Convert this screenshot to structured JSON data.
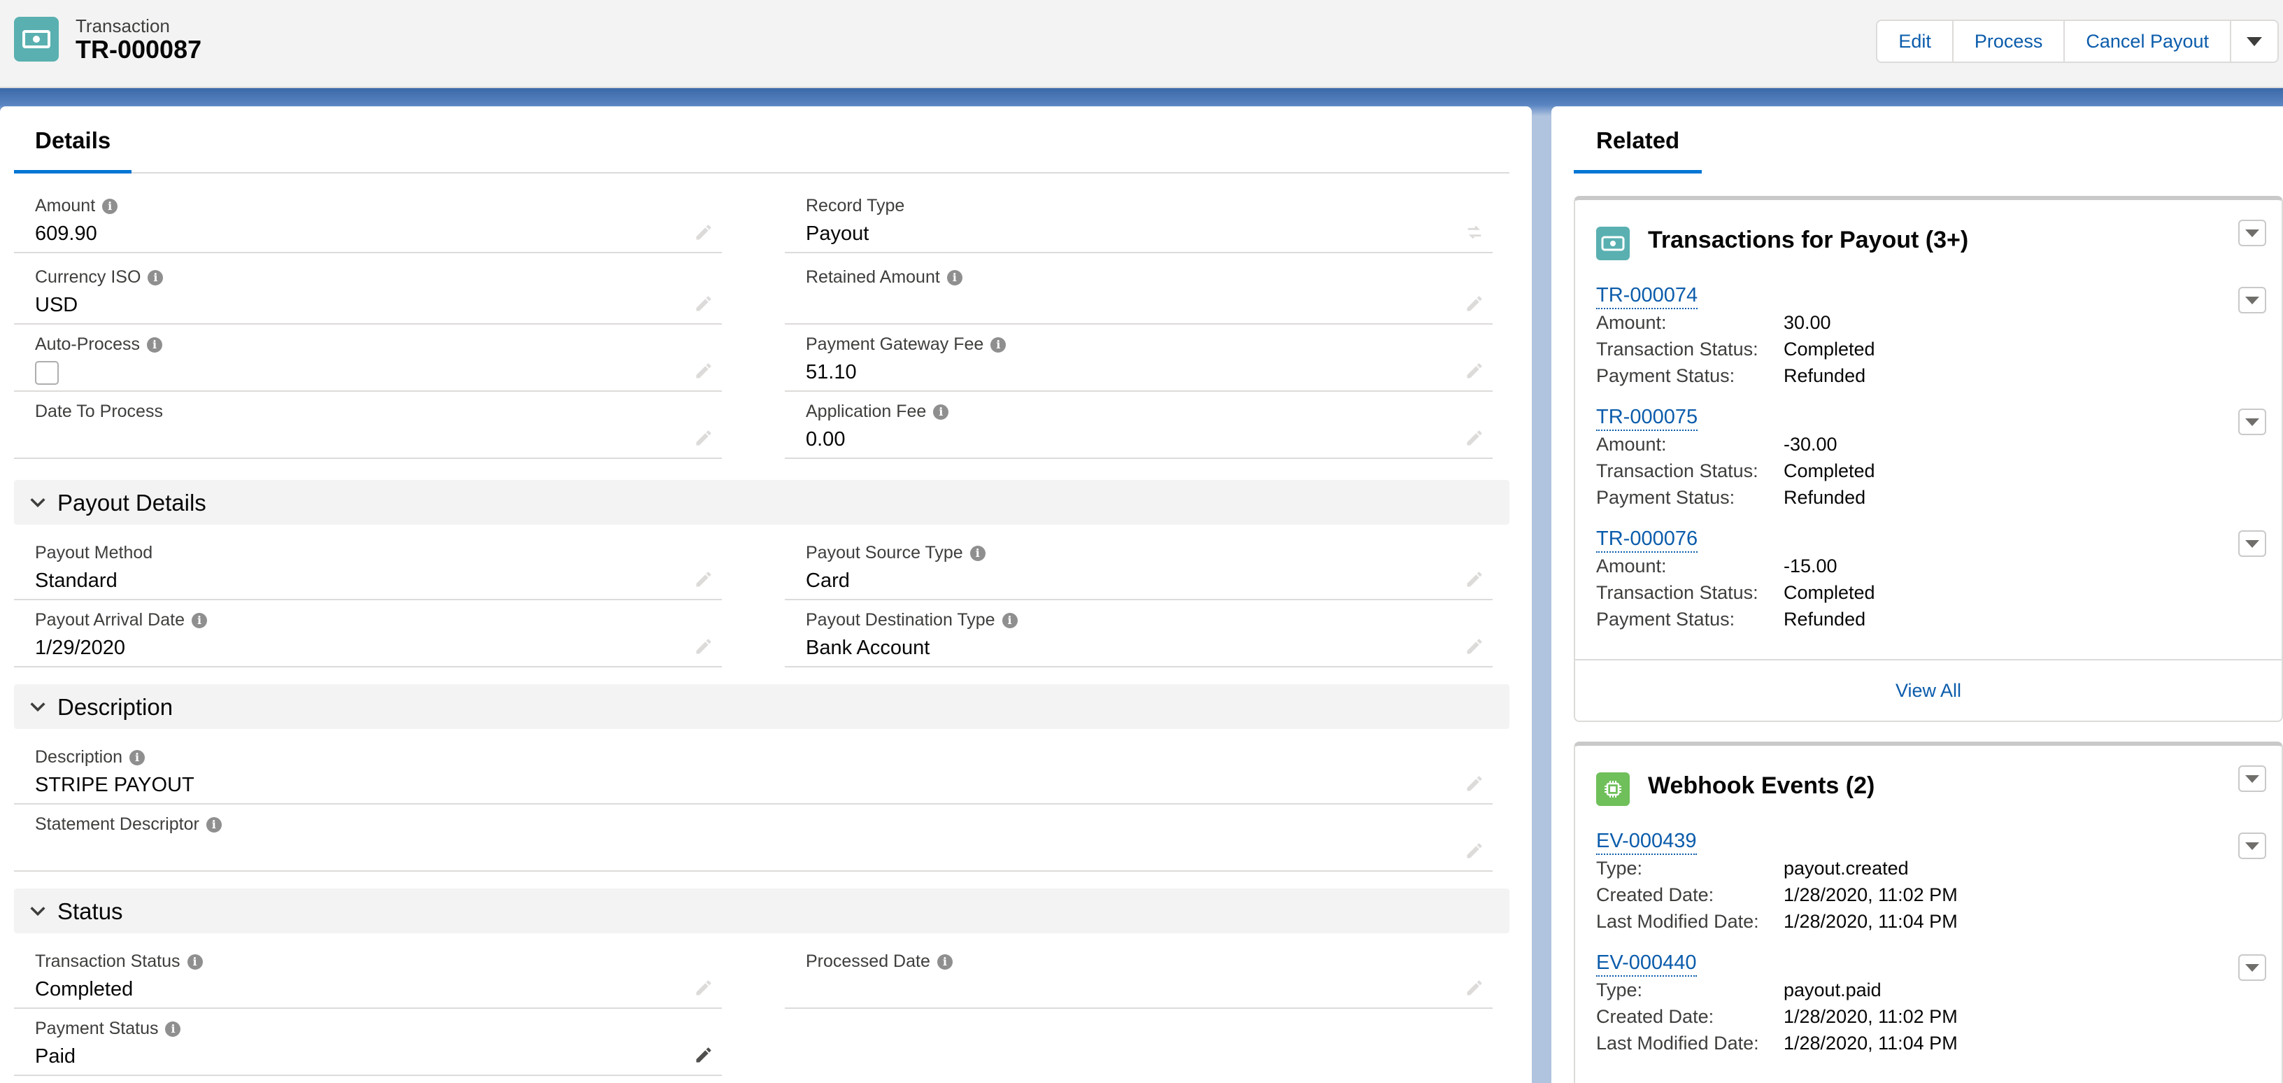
{
  "header": {
    "object_label": "Transaction",
    "record_name": "TR-000087",
    "actions": [
      "Edit",
      "Process",
      "Cancel Payout"
    ]
  },
  "tabs": {
    "details": "Details",
    "related": "Related"
  },
  "fields": {
    "amount": {
      "label": "Amount",
      "value": "609.90"
    },
    "record_type": {
      "label": "Record Type",
      "value": "Payout"
    },
    "currency_iso": {
      "label": "Currency ISO",
      "value": "USD"
    },
    "retained_amount": {
      "label": "Retained Amount",
      "value": ""
    },
    "auto_process": {
      "label": "Auto-Process",
      "checked": false
    },
    "payment_gateway_fee": {
      "label": "Payment Gateway Fee",
      "value": "51.10"
    },
    "date_to_process": {
      "label": "Date To Process",
      "value": ""
    },
    "application_fee": {
      "label": "Application Fee",
      "value": "0.00"
    }
  },
  "sections": {
    "payout_details": {
      "title": "Payout Details",
      "payout_method": {
        "label": "Payout Method",
        "value": "Standard"
      },
      "payout_source_type": {
        "label": "Payout Source Type",
        "value": "Card"
      },
      "payout_arrival_date": {
        "label": "Payout Arrival Date",
        "value": "1/29/2020"
      },
      "payout_destination_type": {
        "label": "Payout Destination Type",
        "value": "Bank Account"
      }
    },
    "description": {
      "title": "Description",
      "description": {
        "label": "Description",
        "value": "STRIPE PAYOUT"
      },
      "statement_descriptor": {
        "label": "Statement Descriptor",
        "value": ""
      }
    },
    "status": {
      "title": "Status",
      "transaction_status": {
        "label": "Transaction Status",
        "value": "Completed"
      },
      "processed_date": {
        "label": "Processed Date",
        "value": ""
      },
      "payment_status": {
        "label": "Payment Status",
        "value": "Paid"
      }
    }
  },
  "related": {
    "transactions_card": {
      "title": "Transactions for Payout (3+)",
      "icon": "money-icon",
      "icon_color": "#5ab0b0",
      "records": [
        {
          "name": "TR-000074",
          "rows": [
            [
              "Amount:",
              "30.00"
            ],
            [
              "Transaction Status:",
              "Completed"
            ],
            [
              "Payment Status:",
              "Refunded"
            ]
          ]
        },
        {
          "name": "TR-000075",
          "rows": [
            [
              "Amount:",
              "-30.00"
            ],
            [
              "Transaction Status:",
              "Completed"
            ],
            [
              "Payment Status:",
              "Refunded"
            ]
          ]
        },
        {
          "name": "TR-000076",
          "rows": [
            [
              "Amount:",
              "-15.00"
            ],
            [
              "Transaction Status:",
              "Completed"
            ],
            [
              "Payment Status:",
              "Refunded"
            ]
          ]
        }
      ],
      "view_all": "View All"
    },
    "webhook_card": {
      "title": "Webhook Events (2)",
      "icon": "chip-icon",
      "icon_color": "#6fbf5a",
      "records": [
        {
          "name": "EV-000439",
          "rows": [
            [
              "Type:",
              "payout.created"
            ],
            [
              "Created Date:",
              "1/28/2020, 11:02 PM"
            ],
            [
              "Last Modified Date:",
              "1/28/2020, 11:04 PM"
            ]
          ]
        },
        {
          "name": "EV-000440",
          "rows": [
            [
              "Type:",
              "payout.paid"
            ],
            [
              "Created Date:",
              "1/28/2020, 11:02 PM"
            ],
            [
              "Last Modified Date:",
              "1/28/2020, 11:04 PM"
            ]
          ]
        }
      ]
    }
  },
  "colors": {
    "brand_blue": "#0176d3",
    "link": "#0b5cab",
    "header_bg": "#f3f3f3"
  }
}
